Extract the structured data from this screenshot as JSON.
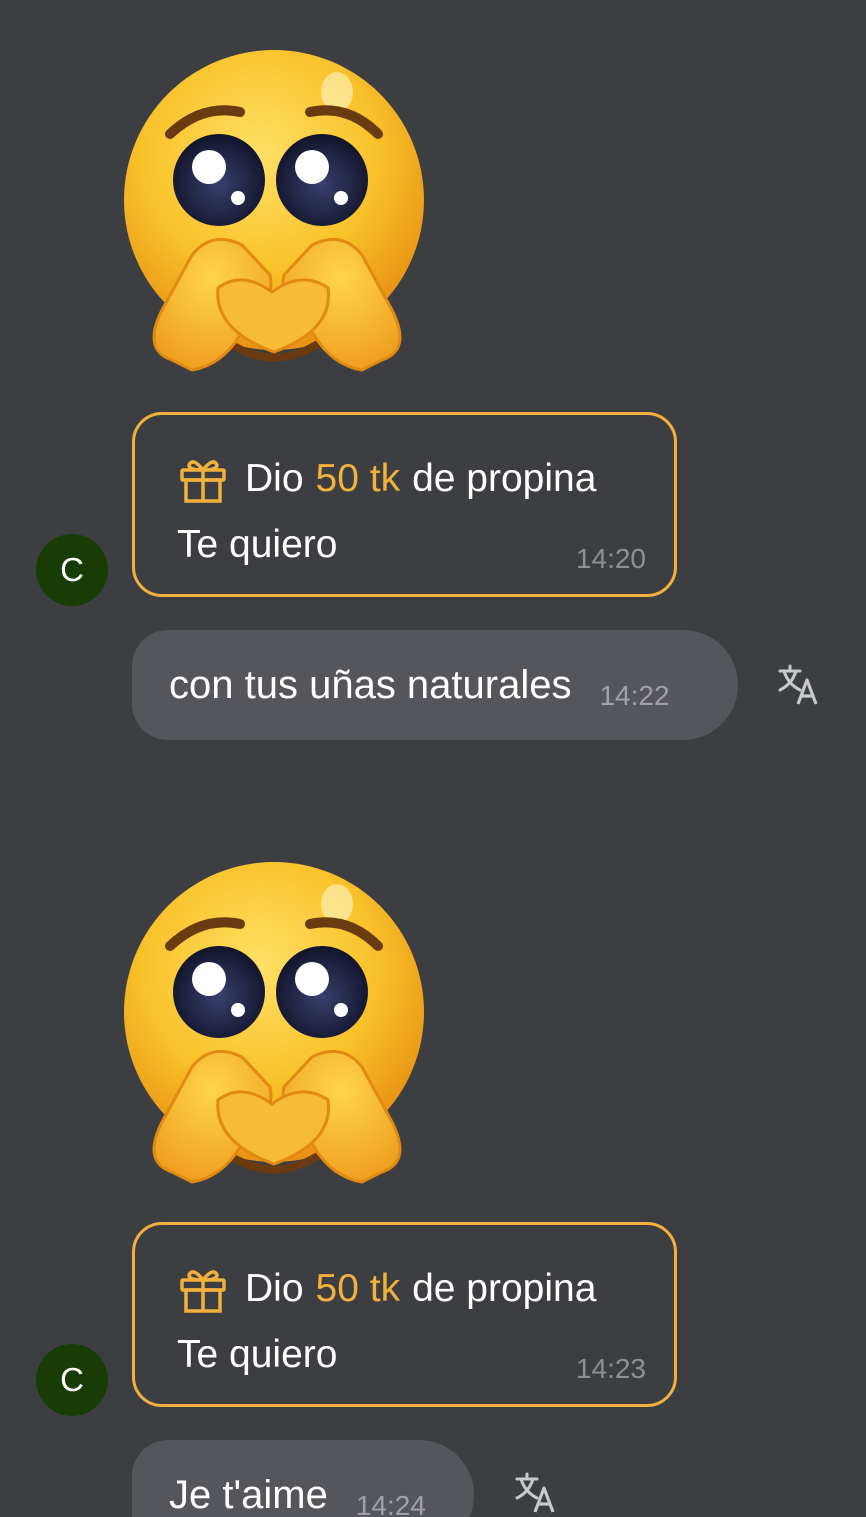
{
  "messages": [
    {
      "sticker": "pleading-face-heart-hands-sticker",
      "tip": {
        "prefix": "Dio",
        "amount": "50 tk",
        "suffix": "de propina",
        "message": "Te quiero",
        "time": "14:20"
      },
      "avatar_letter": "C",
      "reply": {
        "text": "con tus uñas naturales",
        "time": "14:22",
        "icon": "translate-icon"
      }
    },
    {
      "sticker": "pleading-face-heart-hands-sticker",
      "tip": {
        "prefix": "Dio",
        "amount": "50 tk",
        "suffix": "de propina",
        "message": "Te quiero",
        "time": "14:23"
      },
      "avatar_letter": "C",
      "reply": {
        "text": "Je t'aime",
        "time": "14:24",
        "icon": "translate-icon"
      }
    }
  ],
  "colors": {
    "background": "#3d3e42",
    "tip_accent": "#f2b13c",
    "bubble": "#55565c",
    "avatar": "#173c06",
    "timestamp": "#8f9095"
  }
}
